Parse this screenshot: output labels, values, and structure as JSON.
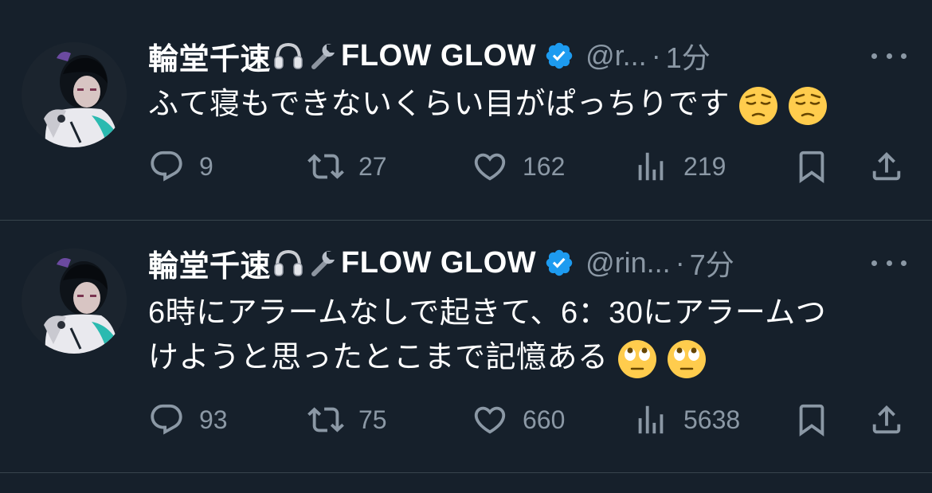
{
  "tweets": [
    {
      "display_name": "輪堂千速",
      "name_suffix": "FLOW GLOW",
      "name_emojis": [
        "headphones-emoji",
        "wrench-emoji"
      ],
      "verified": true,
      "handle": "@r...",
      "separator": "·",
      "time": "1分",
      "text": "ふて寝もできないくらい目がぱっちりです",
      "text_emojis": [
        "pensive-face-emoji",
        "pensive-face-emoji"
      ],
      "replies": "9",
      "retweets": "27",
      "likes": "162",
      "views": "219"
    },
    {
      "display_name": "輪堂千速",
      "name_suffix": "FLOW GLOW",
      "name_emojis": [
        "headphones-emoji",
        "wrench-emoji"
      ],
      "verified": true,
      "handle": "@rin...",
      "separator": "·",
      "time": "7分",
      "text_line1": "6時にアラームなしで起きて、6：30にアラームつ",
      "text_line2": "けようと思ったとこまで記憶ある",
      "text_emojis": [
        "eye-roll-face-emoji",
        "eye-roll-face-emoji"
      ],
      "replies": "93",
      "retweets": "75",
      "likes": "660",
      "views": "5638"
    }
  ],
  "colors": {
    "background": "#16202b",
    "text_primary": "#ffffff",
    "text_secondary": "#8b98a5",
    "divider": "#38444d",
    "verified_badge": "#1d9bf0"
  }
}
